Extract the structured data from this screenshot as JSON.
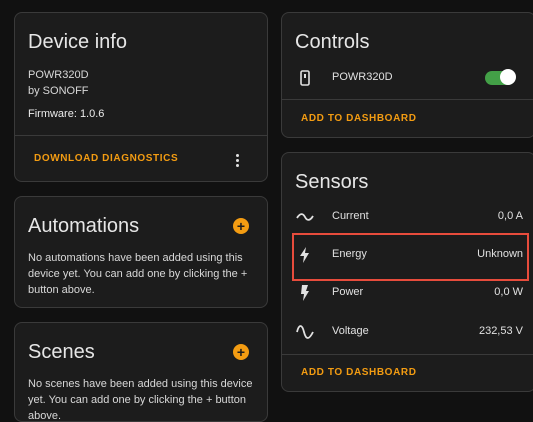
{
  "device_info": {
    "title": "Device info",
    "model": "POWR320D",
    "manufacturer": "by SONOFF",
    "firmware": "Firmware: 1.0.6",
    "download_label": "DOWNLOAD DIAGNOSTICS"
  },
  "automations": {
    "title": "Automations",
    "text": "No automations have been added using this device yet. You can add one by clicking the + button above."
  },
  "scenes": {
    "title": "Scenes",
    "text": "No scenes have been added using this device yet. You can add one by clicking the + button above."
  },
  "controls": {
    "title": "Controls",
    "switch_label": "POWR320D",
    "switch_state": "on",
    "add_label": "ADD TO DASHBOARD"
  },
  "sensors": {
    "title": "Sensors",
    "rows": [
      {
        "label": "Current",
        "value": "0,0 A"
      },
      {
        "label": "Energy",
        "value": "Unknown"
      },
      {
        "label": "Power",
        "value": "0,0 W"
      },
      {
        "label": "Voltage",
        "value": "232,53 V"
      }
    ],
    "add_label": "ADD TO DASHBOARD"
  },
  "colors": {
    "accent": "#f39c12",
    "toggle_on": "#43a047",
    "highlight": "#e74c3c"
  }
}
